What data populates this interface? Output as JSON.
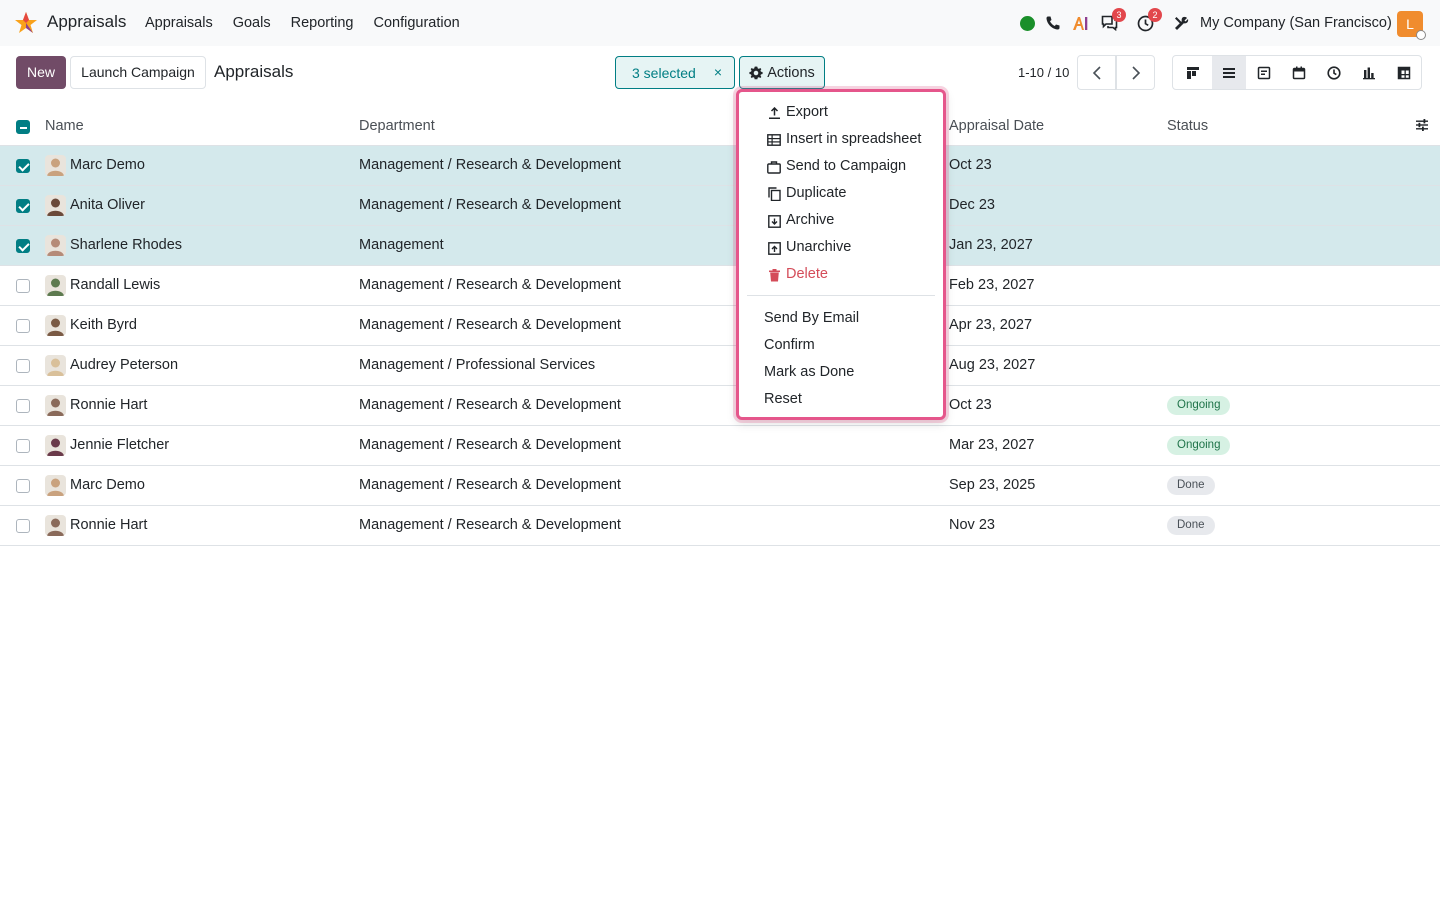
{
  "navbar": {
    "app_name": "Appraisals",
    "menu": [
      "Appraisals",
      "Goals",
      "Reporting",
      "Configuration"
    ],
    "messages_count": "3",
    "activities_count": "2",
    "company": "My Company (San Francisco)",
    "user_initial": "L"
  },
  "control_panel": {
    "new_label": "New",
    "launch_campaign_label": "Launch Campaign",
    "breadcrumb": "Appraisals",
    "selected_label": "3 selected",
    "clear_selection": "×",
    "actions_label": "Actions",
    "pager_value": "1-10 / 10"
  },
  "columns": {
    "name": "Name",
    "department": "Department",
    "appraisal_date": "Appraisal Date",
    "status": "Status"
  },
  "rows": [
    {
      "name": "Marc Demo",
      "department": "Management / Research & Development",
      "date": "Oct 23",
      "status": "",
      "selected": true
    },
    {
      "name": "Anita Oliver",
      "department": "Management / Research & Development",
      "date": "Dec 23",
      "status": "",
      "selected": true
    },
    {
      "name": "Sharlene Rhodes",
      "department": "Management",
      "date": "Jan 23, 2027",
      "status": "",
      "selected": true
    },
    {
      "name": "Randall Lewis",
      "department": "Management / Research & Development",
      "date": "Feb 23, 2027",
      "status": "",
      "selected": false
    },
    {
      "name": "Keith Byrd",
      "department": "Management / Research & Development",
      "date": "Apr 23, 2027",
      "status": "",
      "selected": false
    },
    {
      "name": "Audrey Peterson",
      "department": "Management / Professional Services",
      "date": "Aug 23, 2027",
      "status": "",
      "selected": false
    },
    {
      "name": "Ronnie Hart",
      "department": "Management / Research & Development",
      "date": "Oct 23",
      "status": "Ongoing",
      "selected": false
    },
    {
      "name": "Jennie Fletcher",
      "department": "Management / Research & Development",
      "date": "Mar 23, 2027",
      "status": "Ongoing",
      "selected": false
    },
    {
      "name": "Marc Demo",
      "department": "Management / Research & Development",
      "date": "Sep 23, 2025",
      "status": "Done",
      "selected": false
    },
    {
      "name": "Ronnie Hart",
      "department": "Management / Research & Development",
      "date": "Nov 23",
      "status": "Done",
      "selected": false
    }
  ],
  "actions_menu": {
    "export": "Export",
    "insert_spreadsheet": "Insert in spreadsheet",
    "send_to_campaign": "Send to Campaign",
    "duplicate": "Duplicate",
    "archive": "Archive",
    "unarchive": "Unarchive",
    "delete": "Delete",
    "send_by_email": "Send By Email",
    "confirm": "Confirm",
    "mark_as_done": "Mark as Done",
    "reset": "Reset"
  },
  "colors": {
    "brand": "#714b67",
    "accent": "#017e84",
    "selected_row": "#d4e9ec",
    "highlight": "#e5568b",
    "danger": "#d44c59"
  }
}
